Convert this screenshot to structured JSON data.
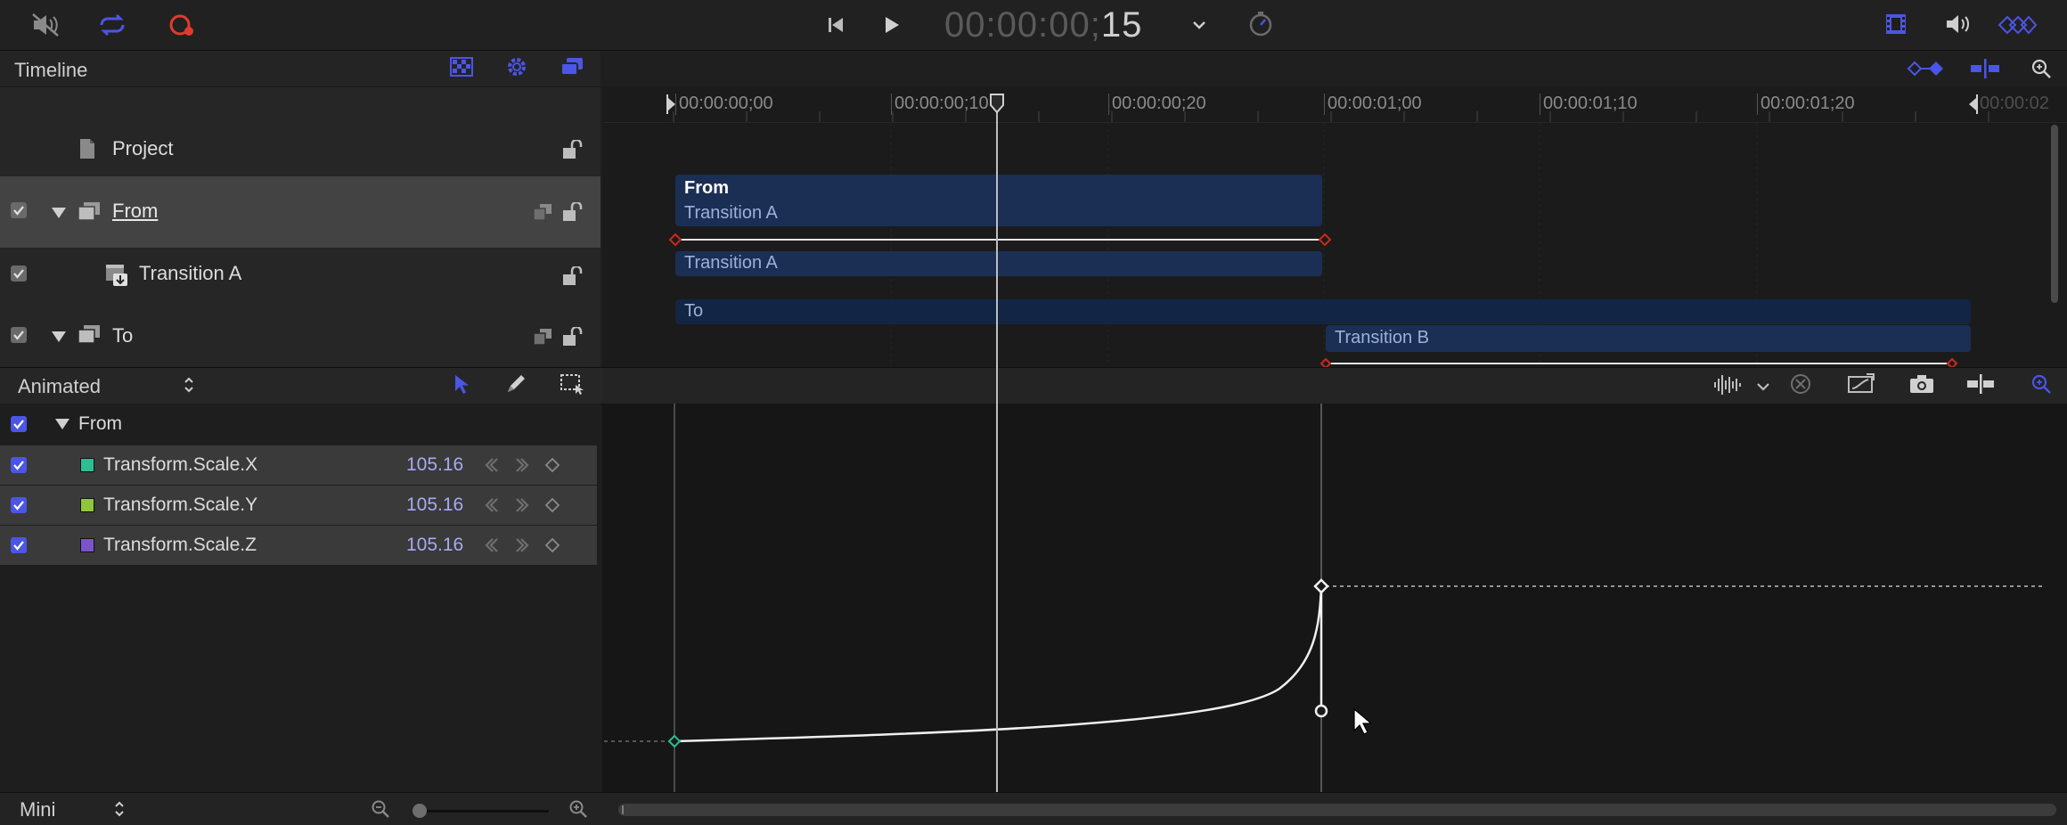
{
  "toolbar": {
    "timecode_dim": "00:00:00;",
    "timecode_frames": "15",
    "icons": [
      "mute-icon",
      "loop-icon",
      "record-icon",
      "skip-to-start-icon",
      "play-icon",
      "timecode-dropdown-icon",
      "playback-speed-icon",
      "film-strip-icon",
      "volume-icon",
      "keyframe-nav-icon"
    ]
  },
  "timeline": {
    "title": "Timeline",
    "ruler_labels": [
      "00:00:00;00",
      "00:00:00;10",
      "00:00:00;20",
      "00:00:01;00",
      "00:00:01;10",
      "00:00:01;20",
      "00:00:02"
    ],
    "layers": [
      {
        "name": "Project"
      },
      {
        "name": "From"
      },
      {
        "name": "Transition A"
      },
      {
        "name": "To"
      }
    ],
    "clips": {
      "from_title": "From",
      "from_sub": "Transition A",
      "transition_a": "Transition A",
      "to": "To",
      "transition_b": "Transition B"
    }
  },
  "curves": {
    "filter_label": "Animated",
    "group_label": "From",
    "params": [
      {
        "name": "Transform.Scale.X",
        "value": "105.16",
        "color": "#2ebd93"
      },
      {
        "name": "Transform.Scale.Y",
        "value": "105.16",
        "color": "#8fc63c"
      },
      {
        "name": "Transform.Scale.Z",
        "value": "105.16",
        "color": "#7a55c9"
      }
    ]
  },
  "bottom": {
    "size_label": "Mini"
  },
  "colors": {
    "accent": "#4b55e6",
    "record": "#e23a2f",
    "keyframe_red": "#c82a1e"
  }
}
